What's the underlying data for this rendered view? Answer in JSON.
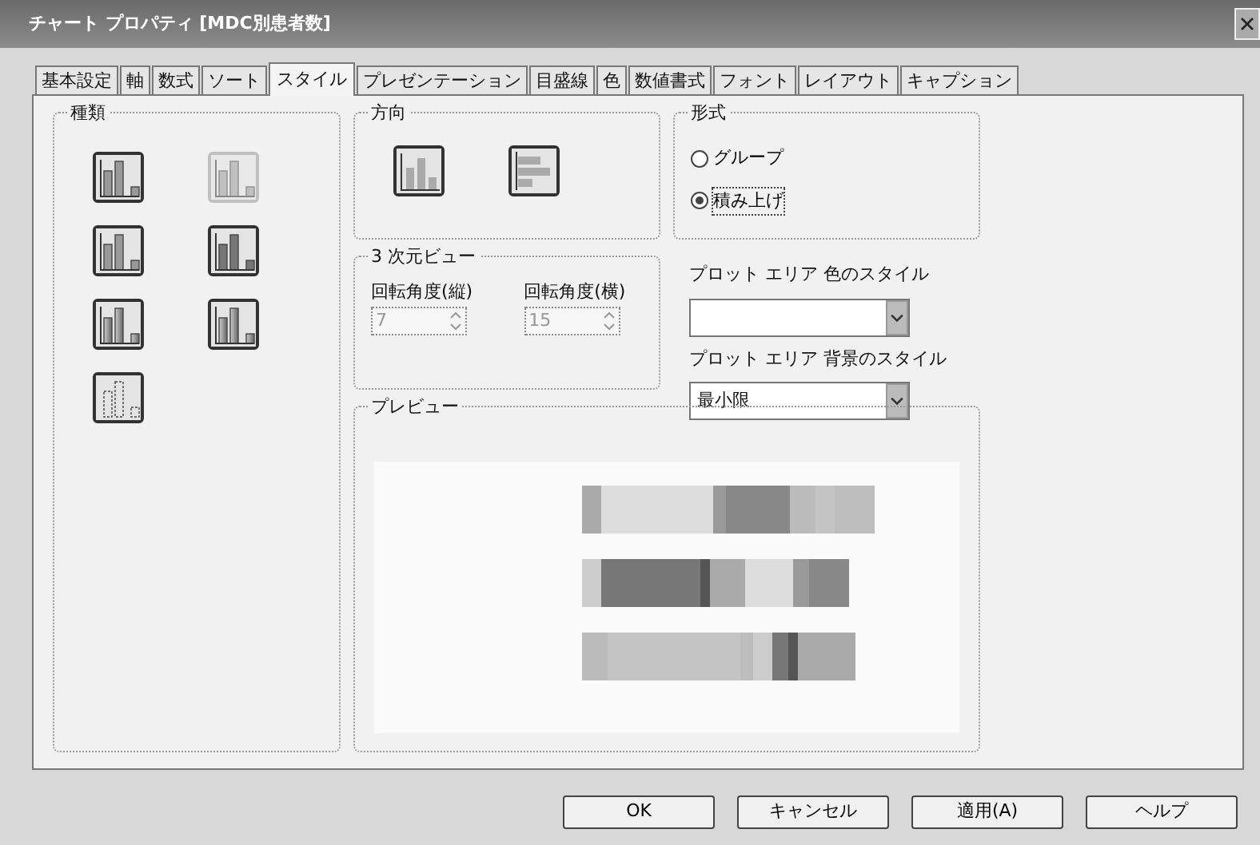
{
  "window": {
    "title": "チャート プロパティ [MDC別患者数]"
  },
  "tabs": [
    {
      "label": "基本設定",
      "selected": false
    },
    {
      "label": "軸",
      "selected": false
    },
    {
      "label": "数式",
      "selected": false
    },
    {
      "label": "ソート",
      "selected": false
    },
    {
      "label": "スタイル",
      "selected": true
    },
    {
      "label": "プレゼンテーション",
      "selected": false
    },
    {
      "label": "目盛線",
      "selected": false
    },
    {
      "label": "色",
      "selected": false
    },
    {
      "label": "数値書式",
      "selected": false
    },
    {
      "label": "フォント",
      "selected": false
    },
    {
      "label": "レイアウト",
      "selected": false
    },
    {
      "label": "キャプション",
      "selected": false
    }
  ],
  "type_group": {
    "title": "種類",
    "items": [
      {
        "kind": "flat",
        "disabled": false
      },
      {
        "kind": "flat",
        "disabled": true
      },
      {
        "kind": "flat",
        "disabled": false
      },
      {
        "kind": "shaded",
        "disabled": false
      },
      {
        "kind": "cylinder",
        "disabled": false
      },
      {
        "kind": "cylinder",
        "disabled": false
      },
      {
        "kind": "outline",
        "disabled": false
      }
    ]
  },
  "direction_group": {
    "title": "方向",
    "items": [
      {
        "kind": "vertical"
      },
      {
        "kind": "horizontal"
      }
    ]
  },
  "format_group": {
    "title": "形式",
    "options": [
      {
        "label": "グループ",
        "selected": false
      },
      {
        "label": "積み上げ",
        "selected": true
      }
    ]
  },
  "view3d_group": {
    "title": "3 次元ビュー",
    "fields": [
      {
        "label": "回転角度(縦)",
        "value": "7",
        "disabled": true
      },
      {
        "label": "回転角度(横)",
        "value": "15",
        "disabled": true
      }
    ]
  },
  "plot_color_style": {
    "label": "プロット エリア 色のスタイル"
  },
  "plot_background_style": {
    "label": "プロット エリア 背景のスタイル",
    "value": "最小限"
  },
  "preview_group": {
    "title": "プレビュー"
  },
  "buttons": [
    "OK",
    "キャンセル",
    "適用(A)",
    "ヘルプ"
  ]
}
